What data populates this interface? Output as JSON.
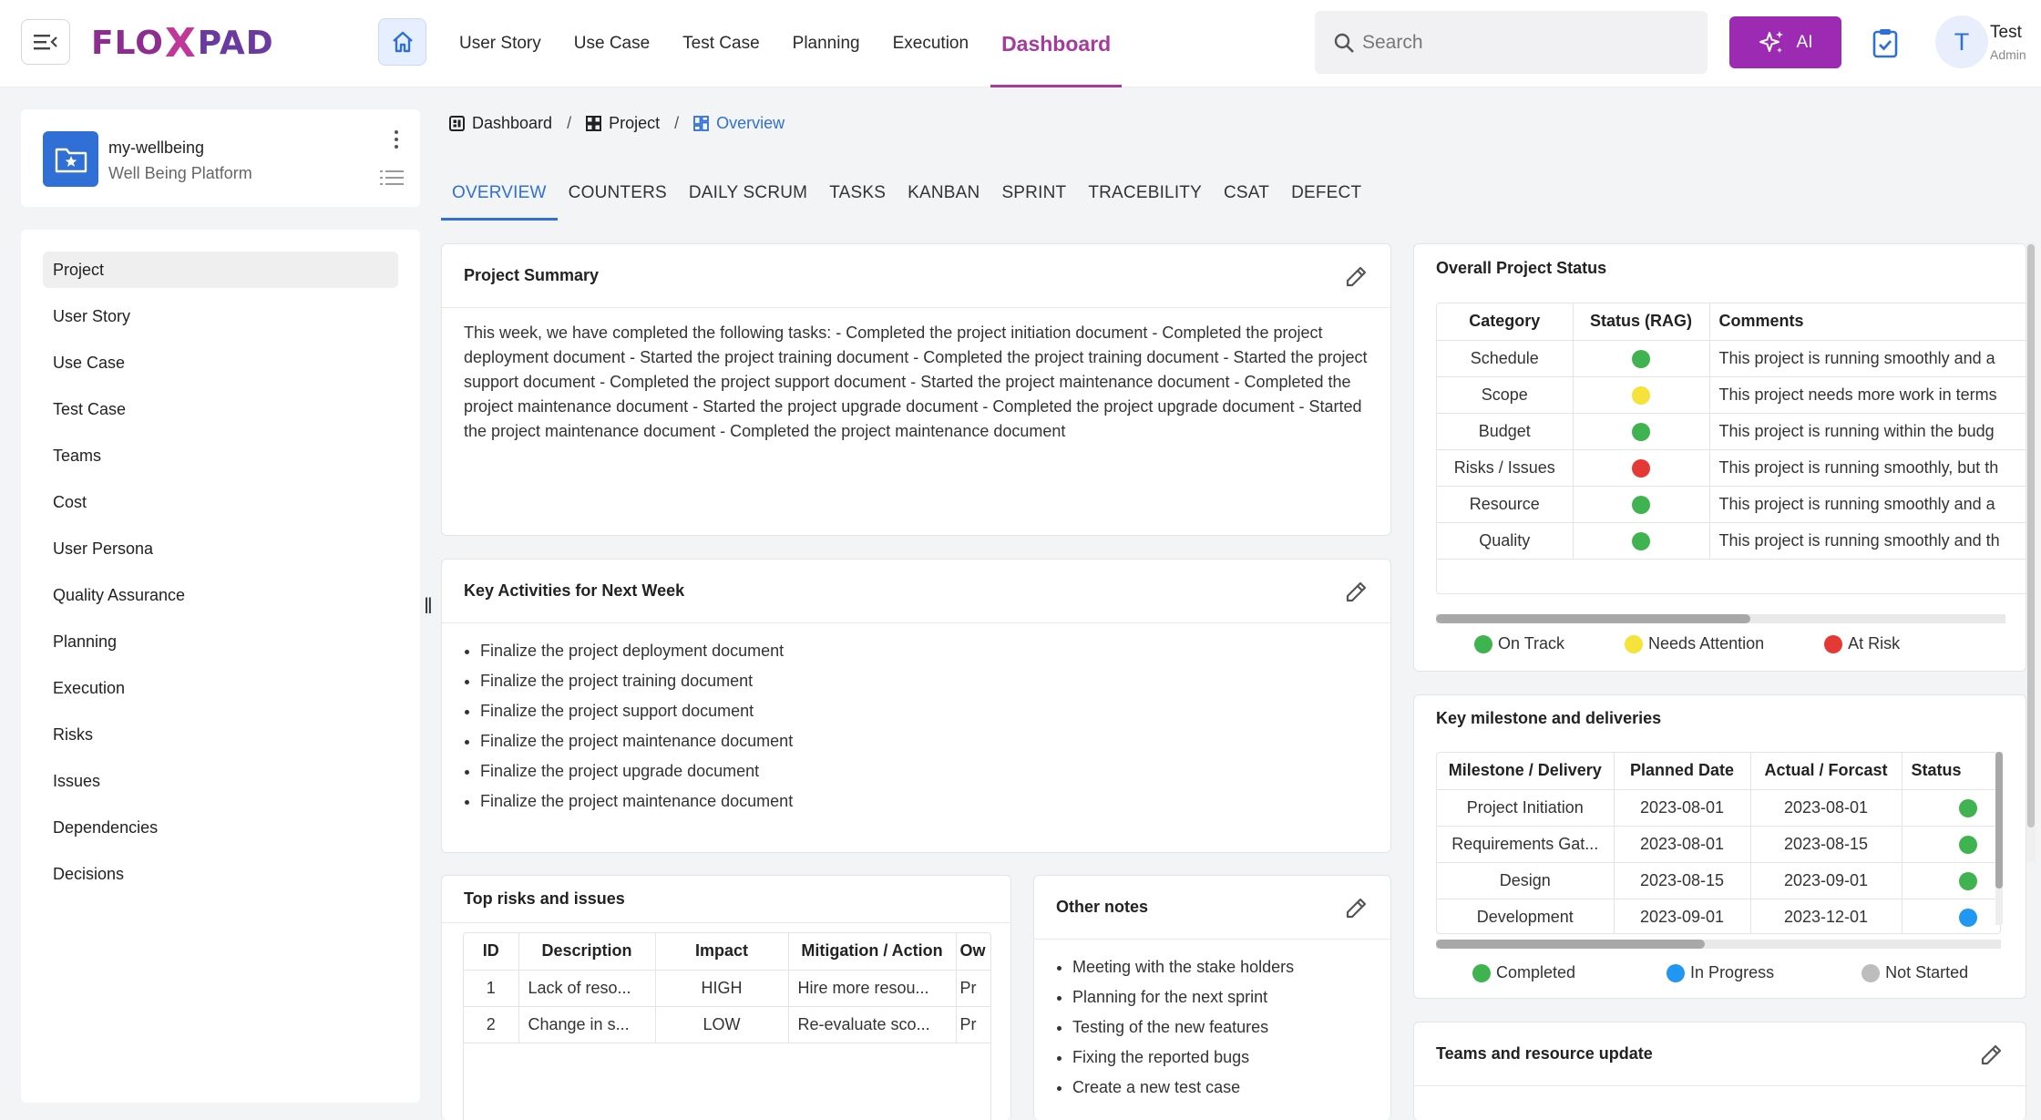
{
  "app": {
    "logo_left": "FLO",
    "logo_x": "X",
    "logo_right": "PAD",
    "nav": [
      "User Story",
      "Use Case",
      "Test Case",
      "Planning",
      "Execution"
    ],
    "nav_active": "Dashboard",
    "search_placeholder": "Search",
    "ai_label": "AI",
    "user_initial": "T",
    "user_name": "Test",
    "user_role": "Admin"
  },
  "project": {
    "name": "my-wellbeing",
    "subtitle": "Well Being Platform"
  },
  "sidebar": {
    "items": [
      "Project",
      "User Story",
      "Use Case",
      "Test Case",
      "Teams",
      "Cost",
      "User Persona",
      "Quality Assurance",
      "Planning",
      "Execution",
      "Risks",
      "Issues",
      "Dependencies",
      "Decisions"
    ],
    "active": "Project"
  },
  "breadcrumb": {
    "dashboard": "Dashboard",
    "project": "Project",
    "overview": "Overview",
    "sep": "/"
  },
  "tabs": [
    "OVERVIEW",
    "COUNTERS",
    "DAILY SCRUM",
    "TASKS",
    "KANBAN",
    "SPRINT",
    "TRACEBILITY",
    "CSAT",
    "DEFECT"
  ],
  "summary": {
    "title": "Project Summary",
    "text": "This week, we have completed the following tasks: - Completed the project initiation document - Completed the project deployment document - Started the project training document - Completed the project training document - Started the project support document - Completed the project support document - Started the project maintenance document - Completed the project maintenance document - Started the project upgrade document - Completed the project upgrade document - Started the project maintenance document - Completed the project maintenance document"
  },
  "key_activities": {
    "title": "Key Activities for Next Week",
    "items": [
      "Finalize the project deployment document",
      "Finalize the project training document",
      "Finalize the project support document",
      "Finalize the project maintenance document",
      "Finalize the project upgrade document",
      "Finalize the project maintenance document"
    ]
  },
  "risks": {
    "title": "Top risks and issues",
    "columns": [
      "ID",
      "Description",
      "Impact",
      "Mitigation / Action",
      "Ow"
    ],
    "rows": [
      [
        "1",
        "Lack of reso...",
        "HIGH",
        "Hire more resou...",
        "Pr"
      ],
      [
        "2",
        "Change in s...",
        "LOW",
        "Re-evaluate sco...",
        "Pr"
      ]
    ]
  },
  "other_notes": {
    "title": "Other notes",
    "items": [
      "Meeting with the stake holders",
      "Planning for the next sprint",
      "Testing of the new features",
      "Fixing the reported bugs",
      "Create a new test case"
    ]
  },
  "status": {
    "title": "Overall Project Status",
    "columns": [
      "Category",
      "Status (RAG)",
      "Comments"
    ],
    "rows": [
      {
        "category": "Schedule",
        "color": "#3fb34f",
        "comment": "This project is running smoothly and a"
      },
      {
        "category": "Scope",
        "color": "#f5e23b",
        "comment": "This project needs more work in terms"
      },
      {
        "category": "Budget",
        "color": "#3fb34f",
        "comment": "This project is running within the budg"
      },
      {
        "category": "Risks / Issues",
        "color": "#e53935",
        "comment": "This project is running smoothly, but th"
      },
      {
        "category": "Resource",
        "color": "#3fb34f",
        "comment": "This project is running smoothly and a"
      },
      {
        "category": "Quality",
        "color": "#3fb34f",
        "comment": "This project is running smoothly and th"
      }
    ],
    "legend": [
      {
        "label": "On Track",
        "color": "#3fb34f"
      },
      {
        "label": "Needs Attention",
        "color": "#f5e23b"
      },
      {
        "label": "At Risk",
        "color": "#e53935"
      }
    ]
  },
  "milestones": {
    "title": "Key milestone and deliveries",
    "columns": [
      "Milestone / Delivery",
      "Planned Date",
      "Actual / Forcast",
      "Status"
    ],
    "rows": [
      {
        "name": "Project Initiation",
        "planned": "2023-08-01",
        "actual": "2023-08-01",
        "color": "#3fb34f"
      },
      {
        "name": "Requirements Gat...",
        "planned": "2023-08-01",
        "actual": "2023-08-15",
        "color": "#3fb34f"
      },
      {
        "name": "Design",
        "planned": "2023-08-15",
        "actual": "2023-09-01",
        "color": "#3fb34f"
      },
      {
        "name": "Development",
        "planned": "2023-09-01",
        "actual": "2023-12-01",
        "color": "#2196f3"
      }
    ],
    "legend": [
      {
        "label": "Completed",
        "color": "#3fb34f"
      },
      {
        "label": "In Progress",
        "color": "#2196f3"
      },
      {
        "label": "Not Started",
        "color": "#bdbdbd"
      }
    ]
  },
  "teams": {
    "title": "Teams and resource update"
  }
}
